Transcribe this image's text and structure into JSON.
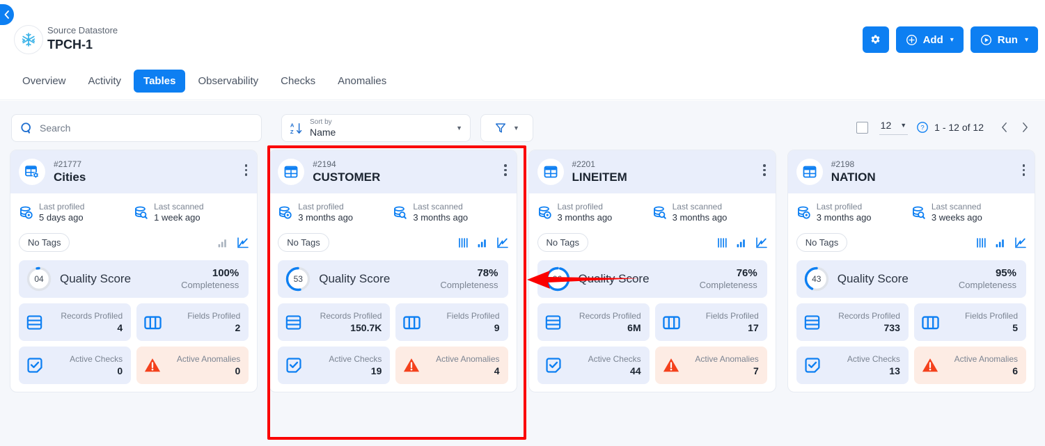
{
  "header": {
    "collapse_icon": "chevron-left-icon",
    "datastore_kind": "Source Datastore",
    "datastore_name": "TPCH-1",
    "logo_icon": "snowflake-icon",
    "settings_label": "",
    "settings_icon": "gear-icon",
    "add_label": "Add",
    "add_icon": "plus-circle-icon",
    "run_label": "Run",
    "run_icon": "play-circle-icon",
    "caret": "▾"
  },
  "tabs": [
    {
      "label": "Overview",
      "active": false
    },
    {
      "label": "Activity",
      "active": false
    },
    {
      "label": "Tables",
      "active": true
    },
    {
      "label": "Observability",
      "active": false
    },
    {
      "label": "Checks",
      "active": false
    },
    {
      "label": "Anomalies",
      "active": false
    }
  ],
  "toolbar": {
    "search_placeholder": "Search",
    "search_value": "",
    "search_icon": "search-icon",
    "sort_caption": "Sort by",
    "sort_value": "Name",
    "sort_icon": "sort-az-icon",
    "filter_icon": "filter-funnel-icon"
  },
  "pagination": {
    "select_all_checkbox": "select-all-checkbox",
    "page_size": "12",
    "help_icon": "help-circle-icon",
    "range": "1 - 12 of 12",
    "prev_icon": "chevron-left-icon",
    "next_icon": "chevron-right-icon"
  },
  "labels": {
    "last_profiled": "Last profiled",
    "last_scanned": "Last scanned",
    "quality_score": "Quality Score",
    "completeness": "Completeness",
    "records_profiled": "Records Profiled",
    "fields_profiled": "Fields Profiled",
    "active_checks": "Active Checks",
    "active_anomalies": "Active Anomalies",
    "no_tags": "No Tags"
  },
  "colors": {
    "accent": "#0d7ff2",
    "tile": "#e9eefb",
    "warn_tile": "#fdece4",
    "warn_icon": "#f4411c",
    "highlight": "#fb0000",
    "muted_text": "#7b8492"
  },
  "cards": [
    {
      "id": "#21777",
      "name": "Cities",
      "header_icon": "table-settings-icon",
      "last_profiled": "5 days ago",
      "last_scanned": "1 week ago",
      "tags": "No Tags",
      "mini_charts": [
        "bar-chart-icon-muted",
        "line-chart-icon"
      ],
      "score": "04",
      "score_pct": 3,
      "completeness": "100%",
      "records_profiled": "4",
      "fields_profiled": "2",
      "active_checks": "0",
      "active_anomalies": "0",
      "highlighted": false
    },
    {
      "id": "#2194",
      "name": "CUSTOMER",
      "header_icon": "table-icon",
      "last_profiled": "3 months ago",
      "last_scanned": "3 months ago",
      "tags": "No Tags",
      "mini_charts": [
        "columns-icon",
        "bar-chart-icon",
        "line-chart-icon"
      ],
      "score": "53",
      "score_pct": 53,
      "completeness": "78%",
      "records_profiled": "150.7K",
      "fields_profiled": "9",
      "active_checks": "19",
      "active_anomalies": "4",
      "highlighted": true
    },
    {
      "id": "#2201",
      "name": "LINEITEM",
      "header_icon": "table-icon",
      "last_profiled": "3 months ago",
      "last_scanned": "3 months ago",
      "tags": "No Tags",
      "mini_charts": [
        "columns-icon",
        "bar-chart-icon",
        "line-chart-icon"
      ],
      "score": "96",
      "score_pct": 96,
      "completeness": "76%",
      "records_profiled": "6M",
      "fields_profiled": "17",
      "active_checks": "44",
      "active_anomalies": "7",
      "highlighted": false
    },
    {
      "id": "#2198",
      "name": "NATION",
      "header_icon": "table-icon",
      "last_profiled": "3 months ago",
      "last_scanned": "3 weeks ago",
      "tags": "No Tags",
      "mini_charts": [
        "columns-icon",
        "bar-chart-icon",
        "line-chart-icon"
      ],
      "score": "43",
      "score_pct": 43,
      "completeness": "95%",
      "records_profiled": "733",
      "fields_profiled": "5",
      "active_checks": "13",
      "active_anomalies": "6",
      "highlighted": false
    }
  ],
  "annotation": {
    "highlight_box": "red-highlight-box",
    "arrow": "red-left-arrow"
  }
}
